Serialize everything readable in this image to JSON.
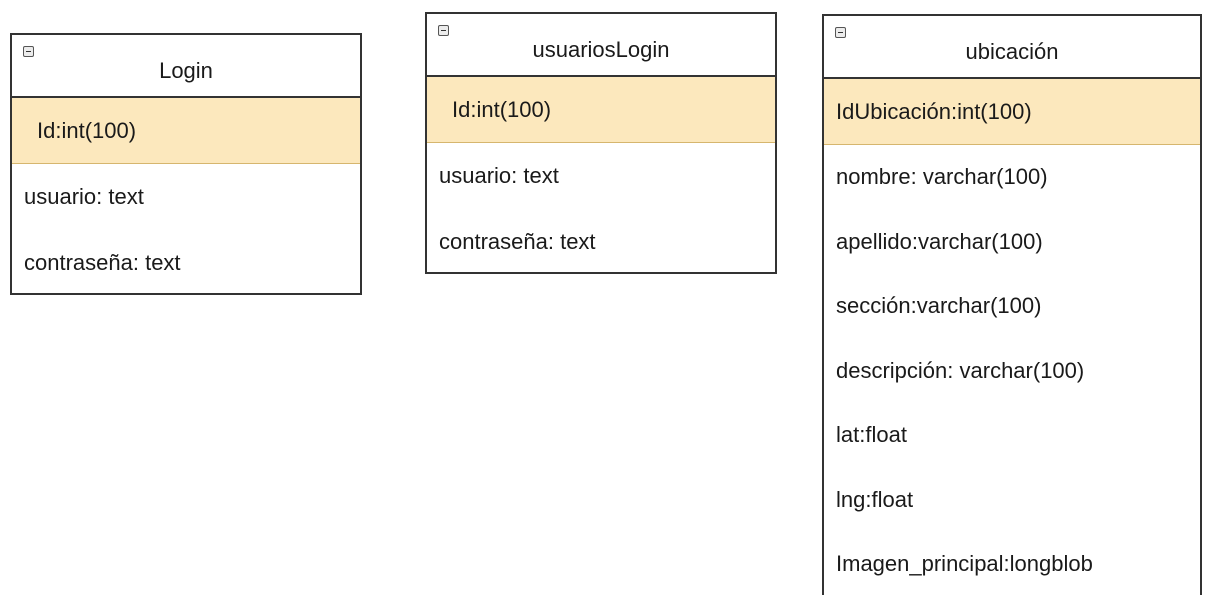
{
  "diagram": {
    "entities": [
      {
        "id": "login",
        "title": "Login",
        "primary_key": "Id:int(100)",
        "fields": [
          "usuario: text",
          "contraseña: text"
        ]
      },
      {
        "id": "usuariosLogin",
        "title": "usuariosLogin",
        "primary_key": "Id:int(100)",
        "fields": [
          "usuario: text",
          "contraseña: text"
        ]
      },
      {
        "id": "ubicacion",
        "title": "ubicación",
        "primary_key": "IdUbicación:int(100)",
        "fields": [
          "nombre: varchar(100)",
          "apellido:varchar(100)",
          "sección:varchar(100)",
          "descripción: varchar(100)",
          "lat:float",
          "lng:float",
          "Imagen_principal:longblob"
        ]
      }
    ],
    "colors": {
      "pk_fill": "#fce8bd",
      "border": "#333333"
    },
    "icons": {
      "collapse": "collapse-minus-icon"
    }
  }
}
